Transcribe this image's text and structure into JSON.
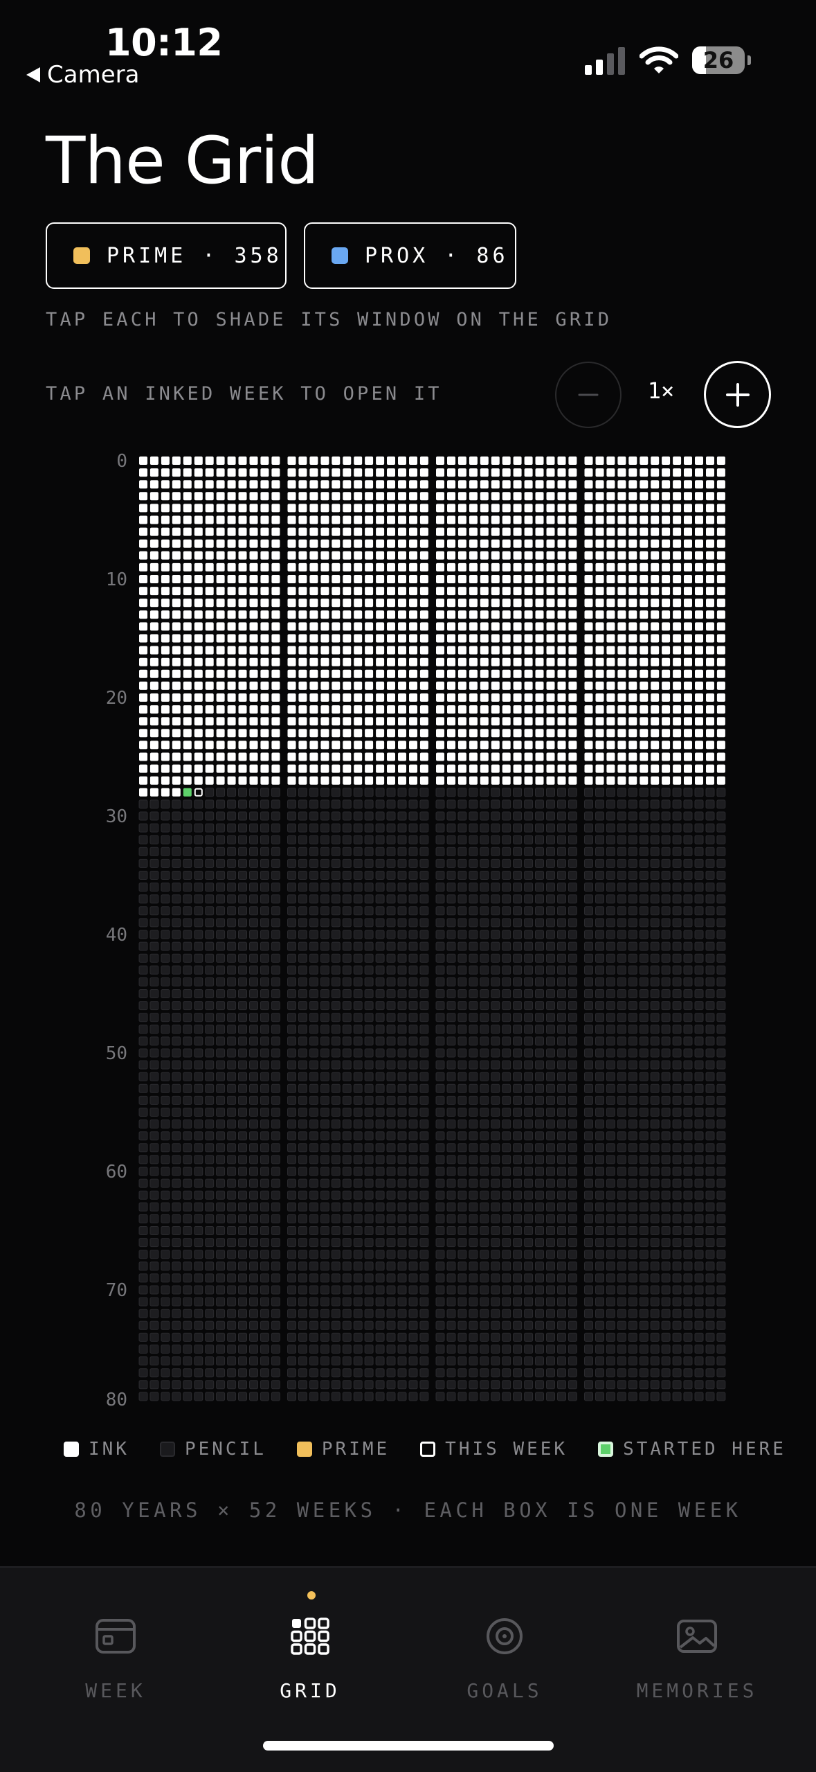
{
  "status_bar": {
    "time": "10:12",
    "back_label": "Camera",
    "battery": "26"
  },
  "page": {
    "title": "The Grid"
  },
  "chips": [
    {
      "label": "PRIME · 358",
      "color": "#f1bf5b"
    },
    {
      "label": "PROX · 86",
      "color": "#6aa8f2"
    }
  ],
  "hints": {
    "shade": "TAP EACH TO SHADE ITS WINDOW ON THE GRID",
    "open": "TAP AN INKED WEEK TO OPEN IT"
  },
  "zoom": {
    "level": "1×",
    "out_icon": "minus-icon",
    "in_icon": "plus-icon"
  },
  "grid": {
    "years": 80,
    "weeks_per_year": 52,
    "weeks_inked": 1460,
    "started_here_week": 1461,
    "this_week": 1462,
    "year_labels": [
      "0",
      "10",
      "20",
      "30",
      "40",
      "50",
      "60",
      "70",
      "80"
    ],
    "colors": {
      "ink": "#ffffff",
      "pencil": "#1d1d20",
      "pencil_border": "#2a2a2e",
      "started": "#5dd06a",
      "this_week_border": "#ffffff"
    }
  },
  "legend": [
    {
      "label": "INK",
      "color": "#ffffff",
      "style": "fill"
    },
    {
      "label": "PENCIL",
      "color": "#2a2a2e",
      "style": "fill-border"
    },
    {
      "label": "PRIME",
      "color": "#f1bf5b",
      "style": "fill"
    },
    {
      "label": "THIS WEEK",
      "color": "#ffffff",
      "style": "outline"
    },
    {
      "label": "STARTED HERE",
      "color": "#5dd06a",
      "style": "started"
    }
  ],
  "footnote": "80 YEARS × 52 WEEKS · EACH BOX IS ONE WEEK",
  "tabs": [
    {
      "label": "WEEK",
      "icon": "calendar-card-icon",
      "active": false
    },
    {
      "label": "GRID",
      "icon": "grid-icon",
      "active": true
    },
    {
      "label": "GOALS",
      "icon": "target-icon",
      "active": false
    },
    {
      "label": "MEMORIES",
      "icon": "image-icon",
      "active": false
    }
  ]
}
